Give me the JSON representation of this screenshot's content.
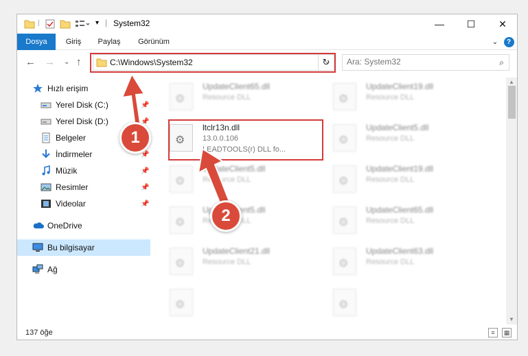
{
  "window": {
    "title": "System32",
    "controls": {
      "minimize": "—",
      "maximize": "☐",
      "close": "✕"
    }
  },
  "ribbon": {
    "tabs": [
      {
        "label": "Dosya",
        "active": true
      },
      {
        "label": "Giriş"
      },
      {
        "label": "Paylaş"
      },
      {
        "label": "Görünüm"
      }
    ],
    "help": "?"
  },
  "nav": {
    "address": "C:\\Windows\\System32",
    "search_placeholder": "Ara: System32"
  },
  "sidebar": {
    "items": [
      {
        "label": "Hızlı erişim",
        "icon": "star-icon",
        "pinned": false
      },
      {
        "label": "Yerel Disk (C:)",
        "icon": "drive-icon",
        "pinned": true
      },
      {
        "label": "Yerel Disk (D:)",
        "icon": "drive-icon",
        "pinned": true
      },
      {
        "label": "Belgeler",
        "icon": "documents-icon",
        "pinned": true
      },
      {
        "label": "İndirmeler",
        "icon": "download-icon",
        "pinned": true
      },
      {
        "label": "Müzik",
        "icon": "music-icon",
        "pinned": true
      },
      {
        "label": "Resimler",
        "icon": "pictures-icon",
        "pinned": true
      },
      {
        "label": "Videolar",
        "icon": "video-icon",
        "pinned": true
      },
      {
        "label": "OneDrive",
        "icon": "cloud-icon",
        "pinned": false
      },
      {
        "label": "Bu bilgisayar",
        "icon": "computer-icon",
        "selected": true
      },
      {
        "label": "Ağ",
        "icon": "network-icon",
        "pinned": false
      }
    ]
  },
  "files": [
    {
      "name": "UpdateClient65.dll",
      "type": "Resource DLL",
      "blurred": true
    },
    {
      "name": "UpdateClient19.dll",
      "type": "Resource DLL",
      "blurred": true
    },
    {
      "name": "ltclr13n.dll",
      "version": "13.0.0.106",
      "description": "LEADTOOLS(r) DLL fo...",
      "blurred": false,
      "highlighted": true
    },
    {
      "name": "UpdateClient5.dll",
      "type": "Resource DLL",
      "blurred": true
    },
    {
      "name": "UpdateClient5.dll",
      "type": "Resource DLL",
      "blurred": true
    },
    {
      "name": "UpdateClient19.dll",
      "type": "Resource DLL",
      "blurred": true
    },
    {
      "name": "UpdateClient5.dll",
      "type": "Resource DLL",
      "blurred": true
    },
    {
      "name": "UpdateClient65.dll",
      "type": "Resource DLL",
      "blurred": true
    },
    {
      "name": "UpdateClient21.dll",
      "type": "Resource DLL",
      "blurred": true
    },
    {
      "name": "UpdateClient63.dll",
      "type": "Resource DLL",
      "blurred": true
    }
  ],
  "status": {
    "count": "137 öğe"
  },
  "annotations": {
    "step1": "1",
    "step2": "2",
    "color": "#d94a3a"
  }
}
